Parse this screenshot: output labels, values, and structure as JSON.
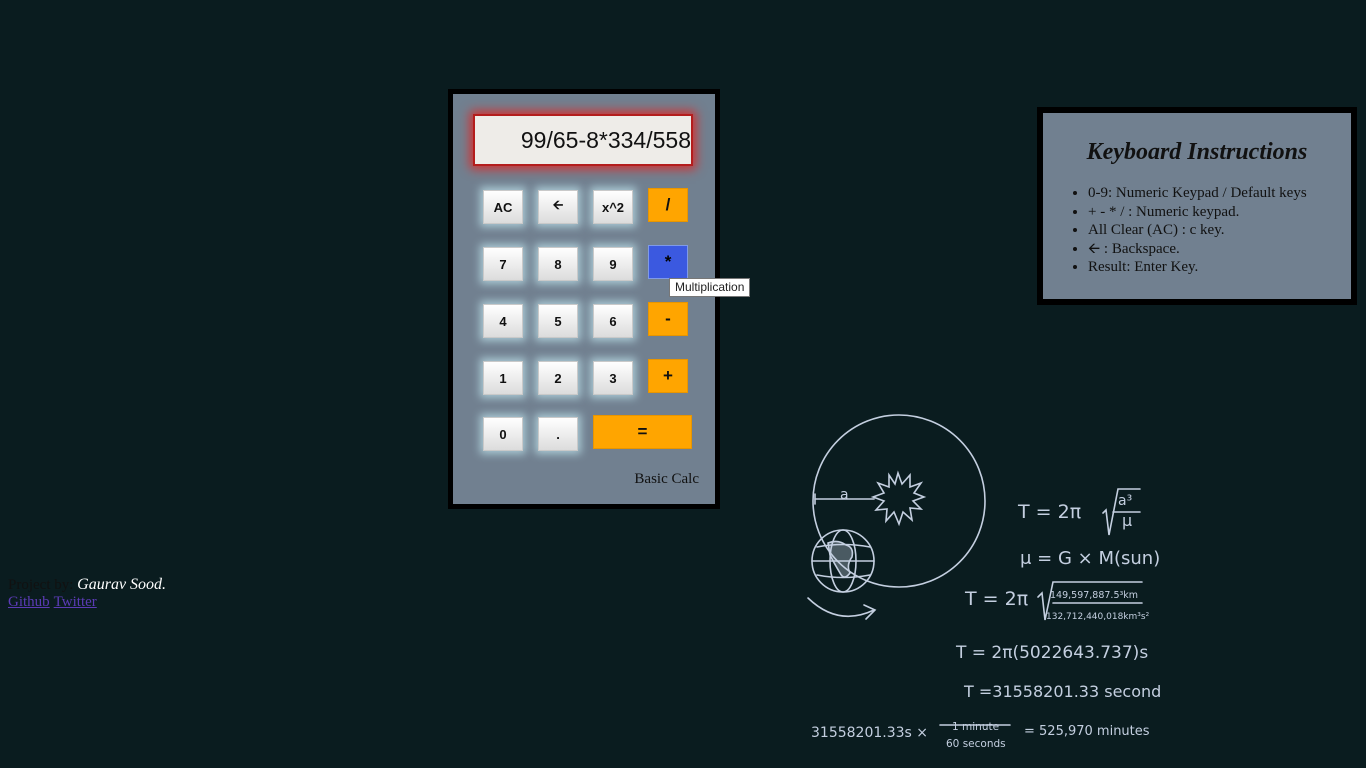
{
  "calculator": {
    "display": "99/65-8*334/558",
    "caption": "Basic Calc",
    "buttons": {
      "ac": "AC",
      "back": "🡨",
      "square": "x^2",
      "divide": "/",
      "seven": "7",
      "eight": "8",
      "nine": "9",
      "multiply": "*",
      "four": "4",
      "five": "5",
      "six": "6",
      "minus": "-",
      "one": "1",
      "two": "2",
      "three": "3",
      "plus": "+",
      "zero": "0",
      "dot": ".",
      "equals": "="
    },
    "tooltip": "Multiplication",
    "colors": {
      "operator": "#ffa500",
      "active_operator": "#3b59e0",
      "display_glow": "#d43030"
    }
  },
  "instructions": {
    "title": "Keyboard Instructions",
    "items": [
      "0-9: Numeric Keypad / Default keys",
      "+ - * / : Numeric keypad.",
      "All Clear (AC) : c key.",
      "🡨 : Backspace.",
      "Result: Enter Key."
    ]
  },
  "credits": {
    "by": "Project by:",
    "name": "Gaurav Sood.",
    "links": [
      "Github",
      "Twitter"
    ]
  },
  "chalkboard": {
    "label_a": "a",
    "eq1": "T = 2π",
    "eq1_num": "a³",
    "eq1_den": "μ",
    "eq2": "μ = G × M(sun)",
    "eq3": "T = 2π",
    "eq3_num": "149,597,887.5³km",
    "eq3_den": "132,712,440,018km³s²",
    "eq4": "T = 2π(5022643.737)s",
    "eq5": "T =31558201.33 seconds",
    "eq6_left": "31558201.33s  ×",
    "eq6_num": "1 minute",
    "eq6_den": "60 seconds",
    "eq6_right": "= 525,970 minutes"
  }
}
